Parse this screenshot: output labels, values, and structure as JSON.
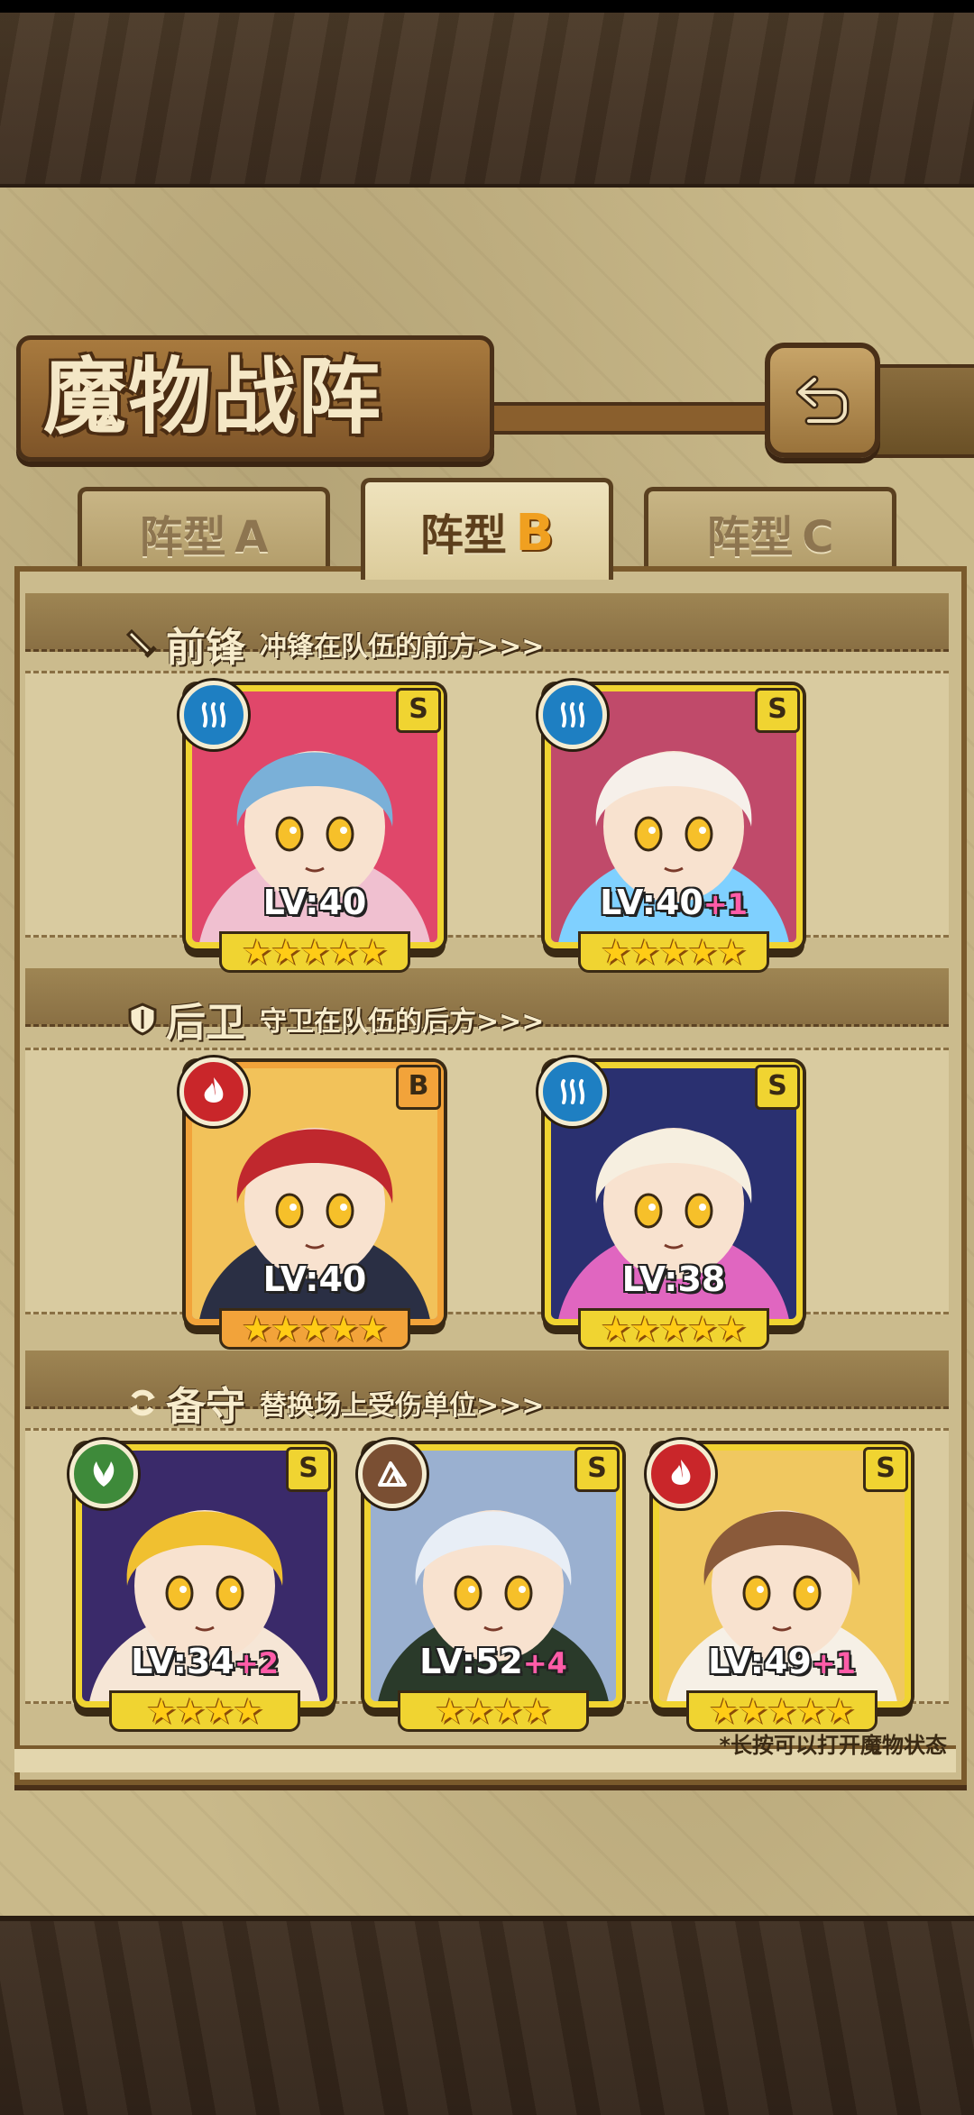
{
  "header": {
    "title": "魔物战阵"
  },
  "tabs": [
    {
      "label_main": "阵型",
      "label_letter": "A",
      "active": false
    },
    {
      "label_main": "阵型",
      "label_letter": "B",
      "active": true
    },
    {
      "label_main": "阵型",
      "label_letter": "C",
      "active": false
    }
  ],
  "sections": [
    {
      "icon": "sword-icon",
      "title": "前锋",
      "description": "冲锋在队伍的前方>>>",
      "monsters": [
        {
          "element": "water-icon",
          "grade": "S",
          "level": "LV:40",
          "bonus": "",
          "stars": 5,
          "frame": "yellow",
          "palette": [
            "#e0476a",
            "#7ab0d8",
            "#f0c0d0"
          ]
        },
        {
          "element": "water-icon",
          "grade": "S",
          "level": "LV:40",
          "bonus": "+1",
          "stars": 5,
          "frame": "yellow",
          "palette": [
            "#c04a6a",
            "#f6f0ea",
            "#7fd0ff"
          ]
        }
      ]
    },
    {
      "icon": "shield-icon",
      "title": "后卫",
      "description": "守卫在队伍的后方>>>",
      "monsters": [
        {
          "element": "fire-icon",
          "grade": "B",
          "level": "LV:40",
          "bonus": "",
          "stars": 5,
          "frame": "gold",
          "palette": [
            "#f2c25a",
            "#c0282e",
            "#2a2f44"
          ]
        },
        {
          "element": "water-icon",
          "grade": "S",
          "level": "LV:38",
          "bonus": "",
          "stars": 5,
          "frame": "yellow",
          "palette": [
            "#2a3070",
            "#f6efe0",
            "#e066c0"
          ]
        }
      ]
    },
    {
      "icon": "swap-icon",
      "title": "备守",
      "description": "替换场上受伤单位>>>",
      "monsters": [
        {
          "element": "leaf-icon",
          "grade": "S",
          "level": "LV:34",
          "bonus": "+2",
          "stars": 4,
          "frame": "yellow",
          "palette": [
            "#3a2a6a",
            "#f0c030",
            "#f6e6d6"
          ]
        },
        {
          "element": "rock-icon",
          "grade": "S",
          "level": "LV:52",
          "bonus": "+4",
          "stars": 4,
          "frame": "yellow",
          "palette": [
            "#9ab0d0",
            "#e8eef6",
            "#2a3a2a"
          ]
        },
        {
          "element": "fire-icon",
          "grade": "S",
          "level": "LV:49",
          "bonus": "+1",
          "stars": 5,
          "frame": "yellow",
          "palette": [
            "#f0c860",
            "#8a5a3a",
            "#f6f0e6"
          ]
        }
      ]
    }
  ],
  "footnote": "*长按可以打开魔物状态",
  "colors": {
    "frame_yellow": "#f0d431",
    "frame_gold": "#f2a33a",
    "bonus_pink": "#ff5ca8"
  }
}
